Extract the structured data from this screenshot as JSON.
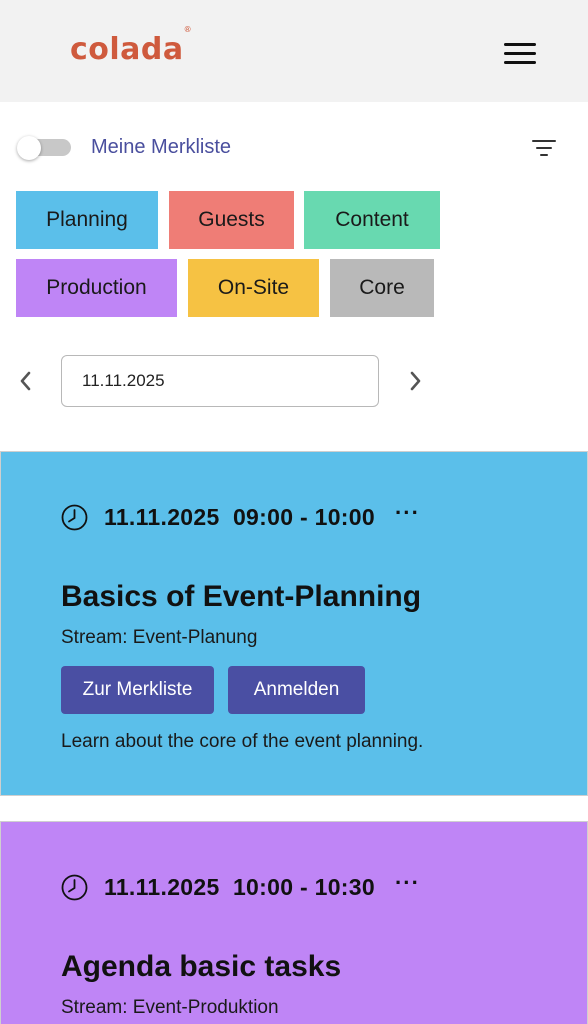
{
  "header": {
    "logo_text": "colada",
    "logo_mark": "®",
    "logo_color": "#cf5a3d",
    "menu_icon": "hamburger-menu-icon"
  },
  "filter_bar": {
    "toggle_label": "Meine Merkliste",
    "toggle_on": false,
    "filter_icon": "filter-icon"
  },
  "categories": [
    {
      "label": "Planning",
      "color": "#5bbfea"
    },
    {
      "label": "Guests",
      "color": "#ef7d76"
    },
    {
      "label": "Content",
      "color": "#68d9b0"
    },
    {
      "label": "Production",
      "color": "#bf85f6"
    },
    {
      "label": "On-Site",
      "color": "#f6c243"
    },
    {
      "label": "Core",
      "color": "#b9b9b9"
    }
  ],
  "date_nav": {
    "value": "11.11.2025",
    "prev_icon": "chevron-left-icon",
    "next_icon": "chevron-right-icon"
  },
  "events": [
    {
      "datetime": "11.11.2025  09:00 - 10:00",
      "more": "···",
      "title": "Basics of Event-Planning",
      "stream": "Stream: Event-Planung",
      "bookmark_label": "Zur Merkliste",
      "register_label": "Anmelden",
      "description": "Learn about the core of the event planning.",
      "color": "#5bbfea"
    },
    {
      "datetime": "11.11.2025  10:00 - 10:30",
      "more": "···",
      "title": "Agenda basic tasks",
      "stream": "Stream: Event-Produktion",
      "color": "#bf85f6"
    }
  ],
  "accent_button_color": "#4a4fa3"
}
